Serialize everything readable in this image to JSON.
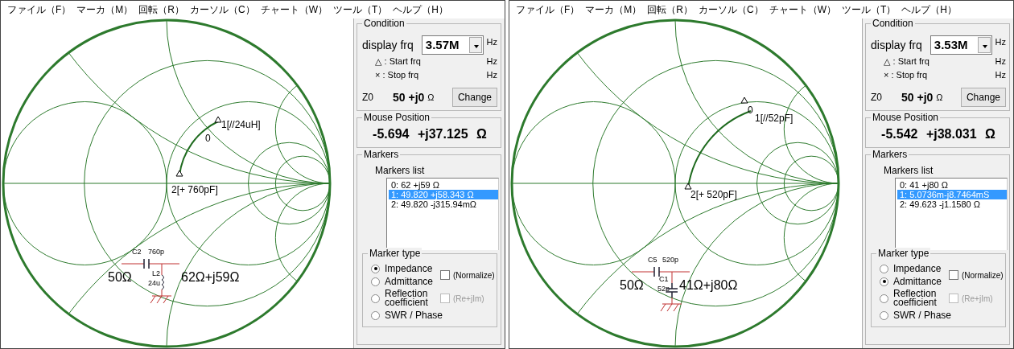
{
  "windows": [
    {
      "menu": [
        "ファイル（F）",
        "マーカ（M）",
        "回転（R）",
        "カーソル（C）",
        "チャート（W）",
        "ツール（T）",
        "ヘルプ（H）"
      ],
      "chart": {
        "labels": [
          "1[//24uH]",
          "0",
          "2[+ 760pF]"
        ],
        "circuit": {
          "source": "50Ω",
          "load": "62Ω+j59Ω",
          "series": {
            "name": "C2",
            "value": "760p"
          },
          "shunt": {
            "kind": "inductor",
            "name": "L2",
            "value": "24u"
          }
        }
      },
      "panel": {
        "condition": {
          "title": "Condition",
          "display_label": "display frq",
          "display_value": "3.57M",
          "display_unit": "Hz",
          "start_label": "△ : Start frq",
          "start_unit": "Hz",
          "stop_label": "× : Stop frq",
          "stop_unit": "Hz",
          "z0_label": "Z0",
          "z0_value": "50 +j0",
          "z0_unit": "Ω",
          "change_button": "Change"
        },
        "mouse_position": {
          "title": "Mouse Position",
          "value": "-5.694 +j37.125 Ω"
        },
        "markers": {
          "title": "Markers",
          "list_label": "Markers list",
          "items": [
            {
              "text": "0: 62 +j59 Ω",
              "selected": false
            },
            {
              "text": "1: 49.820 +j58.343 Ω",
              "selected": true
            },
            {
              "text": "2: 49.820 -j315.94mΩ",
              "selected": false
            }
          ],
          "marker_type": {
            "title": "Marker type",
            "options": [
              {
                "label": "Impedance",
                "selected": true
              },
              {
                "label": "Admittance",
                "selected": false
              },
              {
                "label": "Reflection coefficient",
                "selected": false
              },
              {
                "label": "SWR / Phase",
                "selected": false
              }
            ],
            "normalize": {
              "label": "(Normalize)",
              "checked": false,
              "disabled": false
            },
            "re_im": {
              "label": "(Re+jIm)",
              "checked": false,
              "disabled": true
            }
          }
        }
      }
    },
    {
      "menu": [
        "ファイル（F）",
        "マーカ（M）",
        "回転（R）",
        "カーソル（C）",
        "チャート（W）",
        "ツール（T）",
        "ヘルプ（H）"
      ],
      "chart": {
        "labels": [
          "1[//52pF]",
          "0",
          "2[+ 520pF]"
        ],
        "circuit": {
          "source": "50Ω",
          "load": "41Ω+j80Ω",
          "series": {
            "name": "C5",
            "value": "520p"
          },
          "shunt": {
            "kind": "capacitor",
            "name": "C1",
            "value": "52p"
          }
        }
      },
      "panel": {
        "condition": {
          "title": "Condition",
          "display_label": "display frq",
          "display_value": "3.53M",
          "display_unit": "Hz",
          "start_label": "△ : Start frq",
          "start_unit": "Hz",
          "stop_label": "× : Stop frq",
          "stop_unit": "Hz",
          "z0_label": "Z0",
          "z0_value": "50 +j0",
          "z0_unit": "Ω",
          "change_button": "Change"
        },
        "mouse_position": {
          "title": "Mouse Position",
          "value": "-5.542 +j38.031 Ω"
        },
        "markers": {
          "title": "Markers",
          "list_label": "Markers list",
          "items": [
            {
              "text": "0: 41 +j80 Ω",
              "selected": false
            },
            {
              "text": "1: 5.0736m-j8.7464mS",
              "selected": true
            },
            {
              "text": "2: 49.623 -j1.1580 Ω",
              "selected": false
            }
          ],
          "marker_type": {
            "title": "Marker type",
            "options": [
              {
                "label": "Impedance",
                "selected": false
              },
              {
                "label": "Admittance",
                "selected": true
              },
              {
                "label": "Reflection coefficient",
                "selected": false
              },
              {
                "label": "SWR / Phase",
                "selected": false
              }
            ],
            "normalize": {
              "label": "(Normalize)",
              "checked": false,
              "disabled": false
            },
            "re_im": {
              "label": "(Re+jIm)",
              "checked": false,
              "disabled": true
            }
          }
        }
      }
    }
  ]
}
